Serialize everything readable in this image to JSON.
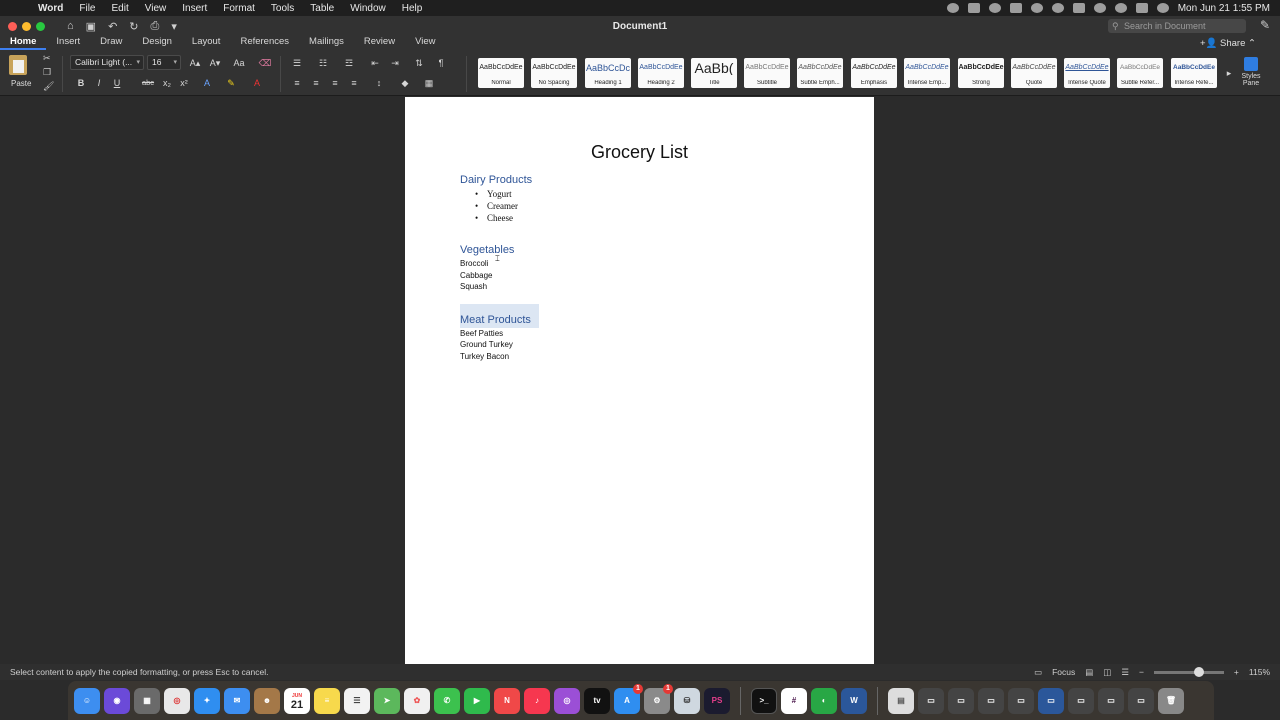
{
  "menubar": {
    "apple": "",
    "items": [
      "Word",
      "File",
      "Edit",
      "View",
      "Insert",
      "Format",
      "Tools",
      "Table",
      "Window",
      "Help"
    ],
    "datetime": "Mon Jun 21  1:55 PM"
  },
  "titlebar": {
    "title": "Document1",
    "search_placeholder": "Search in Document"
  },
  "ribbon_tabs": [
    "Home",
    "Insert",
    "Draw",
    "Design",
    "Layout",
    "References",
    "Mailings",
    "Review",
    "View"
  ],
  "share_label": "Share",
  "ribbon": {
    "paste_label": "Paste",
    "font_name": "Calibri Light (...",
    "font_size": "16",
    "bold": "B",
    "italic": "I",
    "underline": "U",
    "strike": "abc",
    "styles": [
      {
        "sample": "AaBbCcDdEe",
        "name": "Normal"
      },
      {
        "sample": "AaBbCcDdEe",
        "name": "No Spacing"
      },
      {
        "sample": "AaBbCcDc",
        "name": "Heading 1"
      },
      {
        "sample": "AaBbCcDdEe",
        "name": "Heading 2"
      },
      {
        "sample": "AaBb(",
        "name": "Title"
      },
      {
        "sample": "AaBbCcDdEe",
        "name": "Subtitle"
      },
      {
        "sample": "AaBbCcDdEe",
        "name": "Subtle Emph..."
      },
      {
        "sample": "AaBbCcDdEe",
        "name": "Emphasis"
      },
      {
        "sample": "AaBbCcDdEe",
        "name": "Intense Emp..."
      },
      {
        "sample": "AaBbCcDdEe",
        "name": "Strong"
      },
      {
        "sample": "AaBbCcDdEe",
        "name": "Quote"
      },
      {
        "sample": "AaBbCcDdEe",
        "name": "Intense Quote"
      },
      {
        "sample": "AaBbCcDdEe",
        "name": "Subtle Refer..."
      },
      {
        "sample": "AaBbCcDdEe",
        "name": "Intense Refe..."
      }
    ],
    "styles_pane_label": "Styles Pane"
  },
  "document": {
    "title": "Grocery List",
    "sections": {
      "dairy": {
        "heading": "Dairy Products",
        "items": [
          "Yogurt",
          "Creamer",
          "Cheese"
        ]
      },
      "vegetables": {
        "heading": "Vegetables",
        "items": [
          "Broccoli",
          "Cabbage",
          "Squash"
        ]
      },
      "meat": {
        "heading": "Meat Products",
        "items": [
          "Beef Patties",
          "Ground Turkey",
          "Turkey Bacon"
        ]
      }
    }
  },
  "statusbar": {
    "message": "Select content to apply the copied formatting, or press Esc to cancel.",
    "focus_label": "Focus",
    "zoom": "115%"
  },
  "dock": {
    "calendar_month": "JUN",
    "calendar_day": "21",
    "appstore_badge": "1",
    "settings_badge": "1"
  }
}
